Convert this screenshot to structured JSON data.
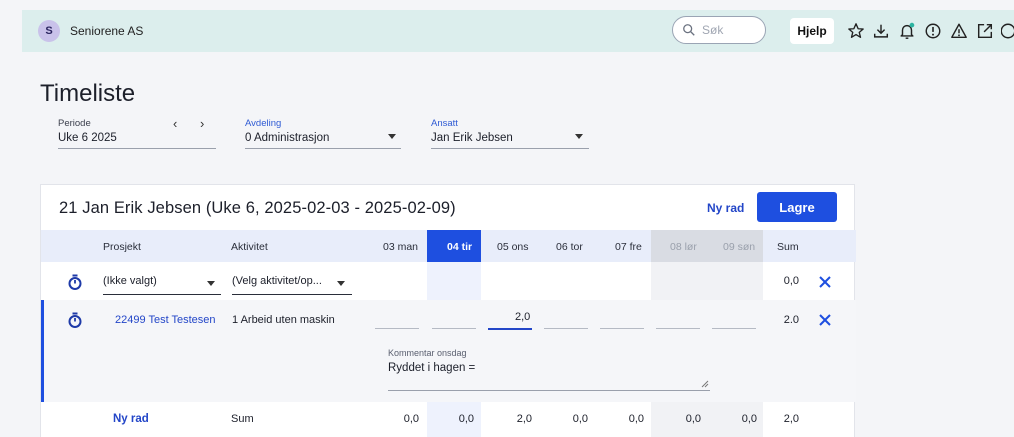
{
  "topbar": {
    "company_initial": "S",
    "company_name": "Seniorene AS",
    "search_placeholder": "Søk",
    "help_label": "Hjelp",
    "icons": [
      "star-icon",
      "download-icon",
      "bell-icon",
      "info-icon",
      "warning-icon",
      "external-link-icon"
    ]
  },
  "page": {
    "title": "Timeliste",
    "periode_label": "Periode",
    "periode_value": "Uke 6 2025",
    "prev_arrow": "‹",
    "next_arrow": "›",
    "avdeling_label": "Avdeling",
    "avdeling_value": "0 Administrasjon",
    "ansatt_label": "Ansatt",
    "ansatt_value": "Jan Erik Jebsen"
  },
  "card": {
    "title": "21 Jan Erik Jebsen (Uke 6, 2025-02-03 - 2025-02-09)",
    "ny_rad_label": "Ny rad",
    "lagre_label": "Lagre",
    "columns": {
      "prosjekt": "Prosjekt",
      "aktivitet": "Aktivitet",
      "days": [
        "03 man",
        "04 tir",
        "05 ons",
        "06 tor",
        "07 fre",
        "08 lør",
        "09 søn"
      ],
      "sum": "Sum"
    },
    "rows": [
      {
        "prosjekt": "(Ikke valgt)",
        "aktivitet": "(Velg aktivitet/op...",
        "sum": "0,0"
      },
      {
        "prosjekt": "22499 Test Testesen",
        "aktivitet": "1 Arbeid uten maskin",
        "active_value": "2,0",
        "sum": "2.0",
        "comment_label": "Kommentar onsdag",
        "comment_value": "Ryddet i hagen ="
      }
    ],
    "footer": {
      "ny_rad_label": "Ny rad",
      "sum_label": "Sum",
      "day_sums": [
        "0,0",
        "0,0",
        "2,0",
        "0,0",
        "0,0",
        "0,0",
        "0,0"
      ],
      "total": "2,0"
    }
  },
  "colors": {
    "accent": "#1e4fe0",
    "topbar_bg": "#dceeed",
    "selected_column_bg": "#eef2fd",
    "weekend_column_bg": "#f1f2f5"
  }
}
